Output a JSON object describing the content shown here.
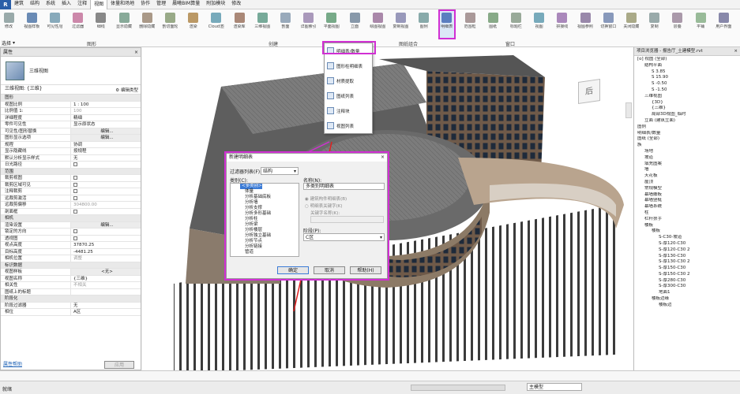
{
  "menu": {
    "tabs": [
      "建筑",
      "结构",
      "系统",
      "插入",
      "注释",
      "视图",
      "体量和场地",
      "协作",
      "管理",
      "晨曦BIM算量",
      "附加模块",
      "修改"
    ],
    "active": "视图"
  },
  "ribbon": {
    "buttons": [
      "修改",
      "视图样板",
      "可见性/图形",
      "过滤器",
      "细线",
      "显示隐藏线",
      "删除隐藏线",
      "剖切面轮廓",
      "渲染",
      "Cloud渲染",
      "渲染库",
      "三维视图",
      "剖面",
      "详图索引",
      "平面视图",
      "立面",
      "绘图视图",
      "复制视图",
      "图例",
      "明细表",
      "范围框",
      "图纸",
      "标题栏",
      "视图",
      "拼接线",
      "视图参照",
      "切换窗口",
      "关闭隐藏对象",
      "复制",
      "层叠",
      "平铺",
      "用户界面"
    ],
    "groups": [
      "图形",
      "创建",
      "图纸组合",
      "窗口"
    ],
    "select_label": "选择"
  },
  "dropdown": {
    "items": [
      "明细表/数量",
      "图形柱明细表",
      "材质提取",
      "图纸列表",
      "注释块",
      "视图列表"
    ]
  },
  "properties": {
    "title": "属性",
    "type_name": "三维视图",
    "instance": "三维视图: {三维}",
    "edit_type": "编辑类型",
    "rows": [
      {
        "s": 1,
        "k": "图形"
      },
      {
        "k": "视图比例",
        "v": "1 : 100"
      },
      {
        "k": "比例值 1:",
        "v": "100",
        "g": 1
      },
      {
        "k": "详细程度",
        "v": "精细"
      },
      {
        "k": "零件可见性",
        "v": "显示原状态"
      },
      {
        "k": "可见性/图形替换",
        "v": "编辑...",
        "b": 1
      },
      {
        "k": "图形显示选项",
        "v": "编辑...",
        "b": 1
      },
      {
        "k": "规程",
        "v": "协调"
      },
      {
        "k": "显示隐藏线",
        "v": "按规程"
      },
      {
        "k": "默认分析显示样式",
        "v": "无"
      },
      {
        "k": "日光路径",
        "v": "",
        "c": 1
      },
      {
        "s": 1,
        "k": "范围"
      },
      {
        "k": "裁剪视图",
        "v": "",
        "c": 1
      },
      {
        "k": "裁剪区域可见",
        "v": "",
        "c": 1
      },
      {
        "k": "注释裁剪",
        "v": "",
        "c": 1
      },
      {
        "k": "远裁剪激活",
        "v": "",
        "c": 1
      },
      {
        "k": "远裁剪偏移",
        "v": "304800.00",
        "g": 1
      },
      {
        "k": "剖面框",
        "v": "",
        "c": 1
      },
      {
        "s": 1,
        "k": "相机"
      },
      {
        "k": "渲染设置",
        "v": "编辑...",
        "b": 1
      },
      {
        "k": "锁定的方向",
        "v": "",
        "c": 1,
        "g": 1
      },
      {
        "k": "透视图",
        "v": "",
        "c": 1,
        "g": 1
      },
      {
        "k": "视点高度",
        "v": "37870.25"
      },
      {
        "k": "目标高度",
        "v": "-4481.25"
      },
      {
        "k": "相机位置",
        "v": "调整",
        "g": 1
      },
      {
        "s": 1,
        "k": "标识数据"
      },
      {
        "k": "视图样板",
        "v": "<无>",
        "b": 1
      },
      {
        "k": "视图名称",
        "v": "{三维}"
      },
      {
        "k": "相关性",
        "v": "不相关",
        "g": 1
      },
      {
        "k": "图纸上的标题",
        "v": ""
      },
      {
        "s": 1,
        "k": "阶段化"
      },
      {
        "k": "阶段过滤器",
        "v": "无"
      },
      {
        "k": "相位",
        "v": "A区"
      }
    ],
    "help_link": "属性帮助",
    "apply": "应用"
  },
  "dialog": {
    "title": "新建明细表",
    "filter_label": "过滤器列表(F):",
    "filter_value": "结构",
    "category_label": "类别(C):",
    "categories": [
      "<多类别>",
      "体量",
      "分析基础底板",
      "分析墙",
      "分析支撑",
      "分析多形基础",
      "分析柱",
      "分析梁",
      "分析楼层",
      "分析独立基础",
      "分析节点",
      "分析链接",
      "管道"
    ],
    "name_label": "名称(N):",
    "name_value": "多类别明细表",
    "radio1": "建筑构件明细表(B)",
    "radio2": "明细表关键字(K)",
    "key_label": "关键字名称(K):",
    "phase_label": "阶段(P):",
    "phase_value": "C区",
    "ok": "确定",
    "cancel": "取消",
    "help": "帮助(H)"
  },
  "browser": {
    "title": "项目浏览器 - 报告厅_土建模型.rvt",
    "items": [
      {
        "d": 0,
        "t": "[o] 视图 (全部)"
      },
      {
        "d": 1,
        "t": "结构平面"
      },
      {
        "d": 2,
        "t": "S 3.85"
      },
      {
        "d": 2,
        "t": "S 15.90"
      },
      {
        "d": 2,
        "t": "S -0.50"
      },
      {
        "d": 2,
        "t": "S -1.50"
      },
      {
        "d": 1,
        "t": "三维视图"
      },
      {
        "d": 2,
        "t": "{3D}"
      },
      {
        "d": 2,
        "t": "{三维}"
      },
      {
        "d": 2,
        "t": "局部3D视图_临时"
      },
      {
        "d": 1,
        "t": "立面 (建筑立面)"
      },
      {
        "d": 0,
        "t": "图例"
      },
      {
        "d": 0,
        "t": "明细表/数量"
      },
      {
        "d": 0,
        "t": "图纸 (全部)"
      },
      {
        "d": 0,
        "t": "族"
      },
      {
        "d": 1,
        "t": "场地"
      },
      {
        "d": 1,
        "t": "坡道"
      },
      {
        "d": 1,
        "t": "填充图案"
      },
      {
        "d": 1,
        "t": "墙"
      },
      {
        "d": 1,
        "t": "天花板"
      },
      {
        "d": 1,
        "t": "屋顶"
      },
      {
        "d": 1,
        "t": "常规模型"
      },
      {
        "d": 1,
        "t": "幕墙嵌板"
      },
      {
        "d": 1,
        "t": "幕墙竖梃"
      },
      {
        "d": 1,
        "t": "幕墙系统"
      },
      {
        "d": 1,
        "t": "柱"
      },
      {
        "d": 1,
        "t": "栏杆扶手"
      },
      {
        "d": 1,
        "t": "楼板"
      },
      {
        "d": 2,
        "t": "楼板"
      },
      {
        "d": 3,
        "t": "S-C30-坡道"
      },
      {
        "d": 3,
        "t": "S-厚120-C30"
      },
      {
        "d": 3,
        "t": "S-厚120-C30 2"
      },
      {
        "d": 3,
        "t": "S-厚130-C30"
      },
      {
        "d": 3,
        "t": "S-厚130-C30 2"
      },
      {
        "d": 3,
        "t": "S-厚150-C30"
      },
      {
        "d": 3,
        "t": "S-厚150-C30 2"
      },
      {
        "d": 3,
        "t": "S-厚280-C30"
      },
      {
        "d": 3,
        "t": "S-厚300-C30"
      },
      {
        "d": 3,
        "t": "地面1"
      },
      {
        "d": 2,
        "t": "楼板边缘"
      },
      {
        "d": 3,
        "t": "楼板边"
      }
    ]
  },
  "status": {
    "left": "就绪",
    "main_model": "主模型"
  },
  "viewcube": {
    "face": "后"
  }
}
